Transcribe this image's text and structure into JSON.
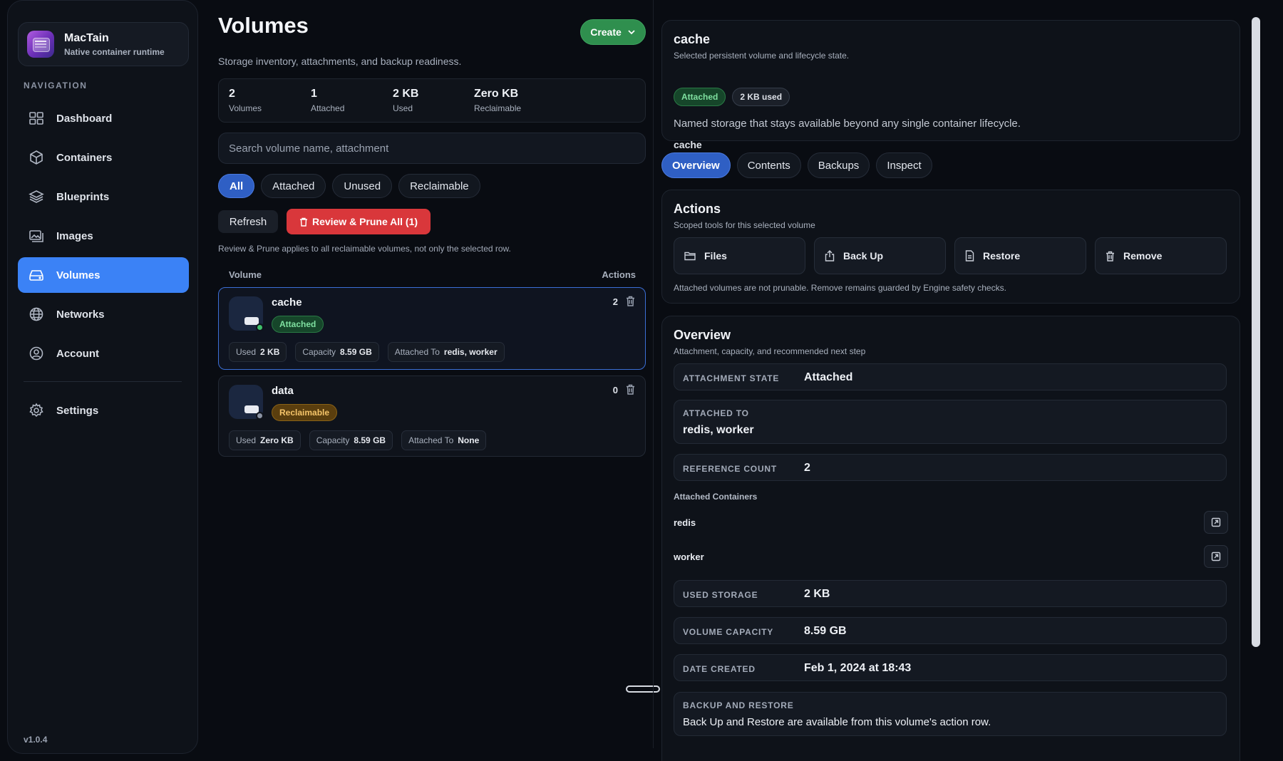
{
  "app": {
    "name": "MacTain",
    "subtitle": "Native container runtime",
    "version": "v1.0.4"
  },
  "nav": {
    "heading": "NAVIGATION",
    "items": [
      {
        "label": "Dashboard",
        "icon": "dashboard-icon"
      },
      {
        "label": "Containers",
        "icon": "cube-icon"
      },
      {
        "label": "Blueprints",
        "icon": "layers-icon"
      },
      {
        "label": "Images",
        "icon": "images-icon"
      },
      {
        "label": "Volumes",
        "icon": "drive-icon",
        "active": true
      },
      {
        "label": "Networks",
        "icon": "globe-icon"
      },
      {
        "label": "Account",
        "icon": "user-icon"
      }
    ],
    "settings": {
      "label": "Settings",
      "icon": "gear-icon"
    }
  },
  "volumes": {
    "title": "Volumes",
    "create_label": "Create",
    "subtitle": "Storage inventory, attachments, and backup readiness.",
    "stats": [
      {
        "value": "2",
        "label": "Volumes"
      },
      {
        "value": "1",
        "label": "Attached"
      },
      {
        "value": "2 KB",
        "label": "Used"
      },
      {
        "value": "Zero KB",
        "label": "Reclaimable"
      }
    ],
    "search_placeholder": "Search volume name, attachment",
    "filters": [
      "All",
      "Attached",
      "Unused",
      "Reclaimable"
    ],
    "active_filter": "All",
    "refresh_label": "Refresh",
    "prune_label": "Review & Prune All (1)",
    "prune_note": "Review & Prune applies to all reclaimable volumes, not only the selected row.",
    "columns": {
      "volume": "Volume",
      "actions": "Actions"
    },
    "list": [
      {
        "name": "cache",
        "status": "Attached",
        "count": "2",
        "used_label": "Used",
        "used": "2 KB",
        "capacity_label": "Capacity",
        "capacity": "8.59 GB",
        "attached_label": "Attached To",
        "attached_to": "redis, worker"
      },
      {
        "name": "data",
        "status": "Reclaimable",
        "count": "0",
        "used_label": "Used",
        "used": "Zero KB",
        "capacity_label": "Capacity",
        "capacity": "8.59 GB",
        "attached_label": "Attached To",
        "attached_to": "None"
      }
    ]
  },
  "detail": {
    "name": "cache",
    "subtitle": "Selected persistent volume and lifecycle state.",
    "status": "Attached",
    "used_pill": "2 KB used",
    "description": "Named storage that stays available beyond any single container lifecycle.",
    "mount_name": "cache",
    "tabs": [
      "Overview",
      "Contents",
      "Backups",
      "Inspect"
    ],
    "active_tab": "Overview",
    "actions": {
      "title": "Actions",
      "subtitle": "Scoped tools for this selected volume",
      "buttons": [
        {
          "label": "Files",
          "icon": "folder-icon"
        },
        {
          "label": "Back Up",
          "icon": "upload-icon"
        },
        {
          "label": "Restore",
          "icon": "file-icon"
        },
        {
          "label": "Remove",
          "icon": "trash-icon"
        }
      ],
      "note": "Attached volumes are not prunable. Remove remains guarded by Engine safety checks."
    },
    "overview": {
      "title": "Overview",
      "subtitle": "Attachment, capacity, and recommended next step",
      "attachment_state_label": "ATTACHMENT STATE",
      "attachment_state": "Attached",
      "attached_to_label": "ATTACHED TO",
      "attached_to": "redis, worker",
      "reference_count_label": "REFERENCE COUNT",
      "reference_count": "2",
      "attached_containers_label": "Attached Containers",
      "containers": [
        "redis",
        "worker"
      ],
      "used_storage_label": "USED STORAGE",
      "used_storage": "2 KB",
      "volume_capacity_label": "VOLUME CAPACITY",
      "volume_capacity": "8.59 GB",
      "date_created_label": "DATE CREATED",
      "date_created": "Feb 1, 2024 at 18:43",
      "backup_label": "BACKUP AND RESTORE",
      "backup_text": "Back Up and Restore are available from this volume's action row."
    }
  },
  "colors": {
    "accent": "#3b82f6",
    "success": "#2f8f4e",
    "danger": "#d9373b",
    "warning": "#f5c46a"
  }
}
